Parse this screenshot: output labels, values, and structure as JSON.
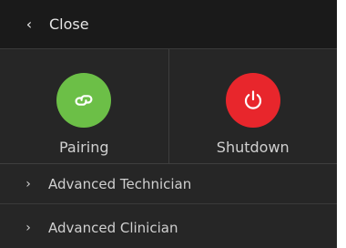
{
  "header": {
    "label": "Close"
  },
  "tiles": {
    "pairing": {
      "label": "Pairing",
      "color": "#6cbf47"
    },
    "shutdown": {
      "label": "Shutdown",
      "color": "#e8262c"
    }
  },
  "menu": {
    "items": [
      {
        "label": "Advanced Technician"
      },
      {
        "label": "Advanced Clinician"
      }
    ]
  },
  "icons": {
    "close_chevron": "chevron-left-icon",
    "pairing": "link-icon",
    "shutdown": "power-icon",
    "row_chevron": "chevron-right-icon"
  }
}
